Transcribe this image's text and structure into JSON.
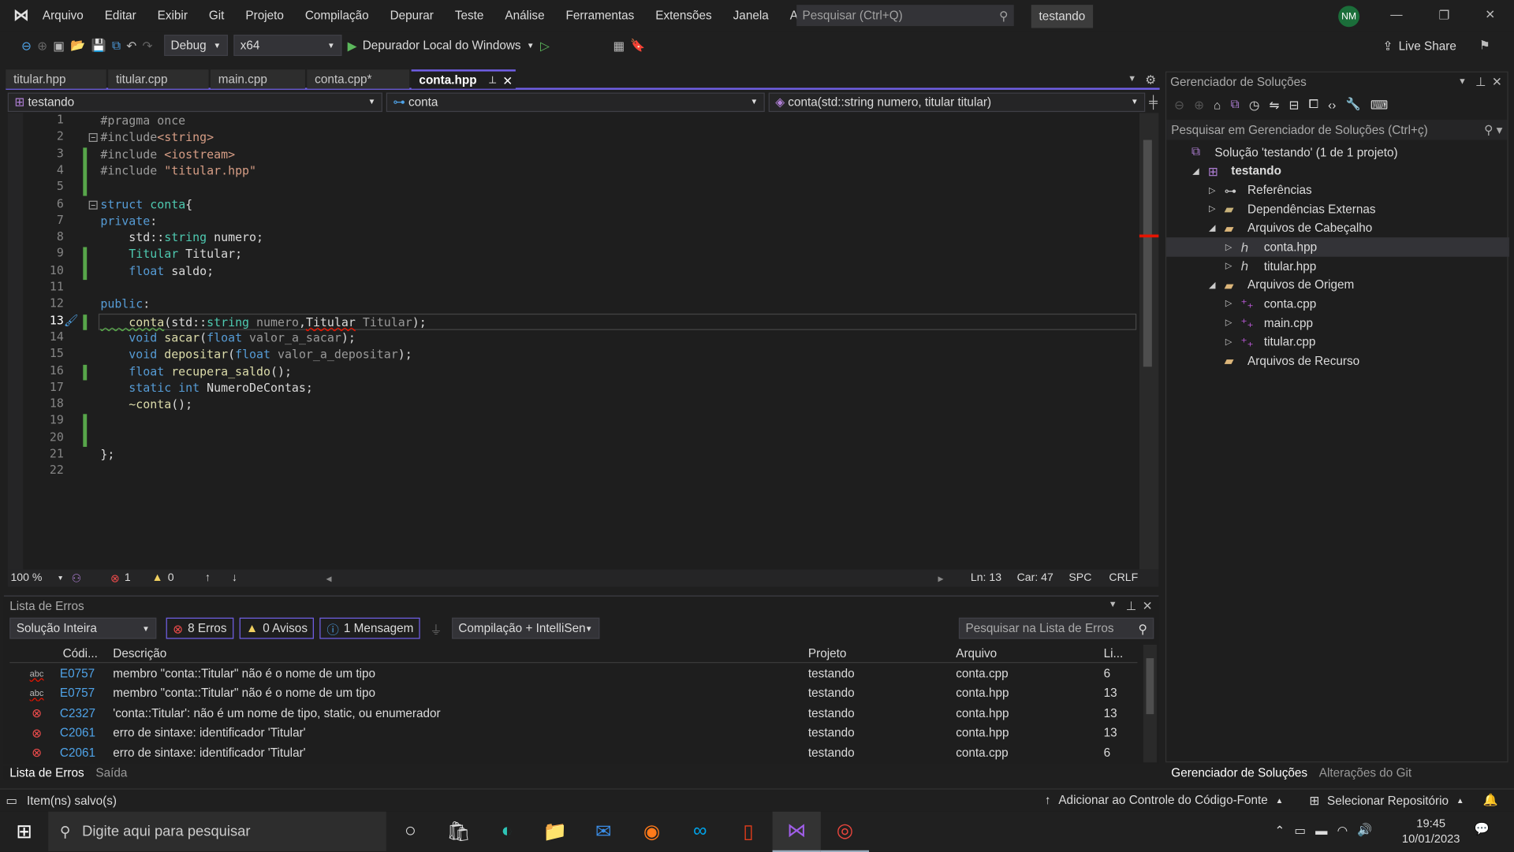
{
  "menu": {
    "items": [
      "Arquivo",
      "Editar",
      "Exibir",
      "Git",
      "Projeto",
      "Compilação",
      "Depurar",
      "Teste",
      "Análise",
      "Ferramentas",
      "Extensões",
      "Janela",
      "Ajuda"
    ],
    "search_placeholder": "Pesquisar (Ctrl+Q)",
    "solution_name": "testando",
    "avatar": "NM"
  },
  "toolbar": {
    "config": "Debug",
    "platform": "x64",
    "run_label": "Depurador Local do Windows",
    "live_share": "Live Share"
  },
  "tabs": [
    {
      "label": "titular.hpp"
    },
    {
      "label": "titular.cpp"
    },
    {
      "label": "main.cpp"
    },
    {
      "label": "conta.cpp*"
    },
    {
      "label": "conta.hpp",
      "active": true
    }
  ],
  "navbar": {
    "project": "testando",
    "scope": "conta",
    "member": "conta(std::string numero, titular titular)"
  },
  "code": {
    "current_line": 13,
    "lines": [
      [
        [
          "pp",
          "#pragma once"
        ]
      ],
      [
        [
          "pp",
          "#include"
        ],
        [
          "s",
          "<string>"
        ]
      ],
      [
        [
          "pp",
          "#include "
        ],
        [
          "s",
          "<iostream>"
        ]
      ],
      [
        [
          "pp",
          "#include "
        ],
        [
          "s",
          "\"titular.hpp\""
        ]
      ],
      [],
      [
        [
          "k",
          "struct "
        ],
        [
          "ty",
          "conta"
        ],
        [
          "p",
          "{"
        ]
      ],
      [
        [
          "k",
          "private"
        ],
        [
          "p",
          ":"
        ]
      ],
      [
        [
          "p",
          "    std::"
        ],
        [
          "ty",
          "string"
        ],
        [
          "m",
          " numero"
        ],
        [
          "p",
          ";"
        ]
      ],
      [
        [
          "ty",
          "    Titular"
        ],
        [
          "m",
          " Titular"
        ],
        [
          "p",
          ";"
        ]
      ],
      [
        [
          "k",
          "    float"
        ],
        [
          "m",
          " saldo"
        ],
        [
          "p",
          ";"
        ]
      ],
      [],
      [
        [
          "k",
          "public"
        ],
        [
          "p",
          ":"
        ]
      ],
      [
        [
          "fn",
          "    conta"
        ],
        [
          "p",
          "(std::"
        ],
        [
          "ty",
          "string"
        ],
        [
          "pa",
          " numero"
        ],
        [
          "p",
          ","
        ],
        [
          "m",
          "Titular"
        ],
        [
          "pa",
          " Titular"
        ],
        [
          "p",
          ");"
        ]
      ],
      [
        [
          "k",
          "    void "
        ],
        [
          "fn",
          "sacar"
        ],
        [
          "p",
          "("
        ],
        [
          "k",
          "float"
        ],
        [
          "pa",
          " valor_a_sacar"
        ],
        [
          "p",
          ");"
        ]
      ],
      [
        [
          "k",
          "    void "
        ],
        [
          "fn",
          "depositar"
        ],
        [
          "p",
          "("
        ],
        [
          "k",
          "float"
        ],
        [
          "pa",
          " valor_a_depositar"
        ],
        [
          "p",
          ");"
        ]
      ],
      [
        [
          "k",
          "    float "
        ],
        [
          "fn",
          "recupera_saldo"
        ],
        [
          "p",
          "();"
        ]
      ],
      [
        [
          "k",
          "    static int "
        ],
        [
          "m",
          "NumeroDeContas"
        ],
        [
          "p",
          ";"
        ]
      ],
      [
        [
          "fn",
          "    ~conta"
        ],
        [
          "p",
          "();"
        ]
      ],
      [],
      [],
      [
        [
          "p",
          "};"
        ]
      ],
      []
    ]
  },
  "editor_status": {
    "zoom": "100 %",
    "errors": "1",
    "warnings": "0",
    "line": "Ln: 13",
    "col": "Car: 47",
    "spaces": "SPC",
    "eol": "CRLF"
  },
  "error_list": {
    "title": "Lista de Erros",
    "scope": "Solução Inteira",
    "errors_filter": "8 Erros",
    "warnings_filter": "0 Avisos",
    "messages_filter": "1 Mensagem",
    "source": "Compilação + IntelliSens",
    "search_placeholder": "Pesquisar na Lista de Erros",
    "columns": [
      "Códi...",
      "Descrição",
      "Projeto",
      "Arquivo",
      "Li..."
    ],
    "rows": [
      {
        "icon": "intellisense-error",
        "code": "E0757",
        "description": "membro \"conta::Titular\" não é o nome de um tipo",
        "project": "testando",
        "file": "conta.cpp",
        "line": "6"
      },
      {
        "icon": "intellisense-error",
        "code": "E0757",
        "description": "membro \"conta::Titular\" não é o nome de um tipo",
        "project": "testando",
        "file": "conta.hpp",
        "line": "13"
      },
      {
        "icon": "error",
        "code": "C2327",
        "description": "'conta::Titular': não é um nome de tipo, static, ou enumerador",
        "project": "testando",
        "file": "conta.hpp",
        "line": "13"
      },
      {
        "icon": "error",
        "code": "C2061",
        "description": "erro de sintaxe: identificador 'Titular'",
        "project": "testando",
        "file": "conta.hpp",
        "line": "13"
      },
      {
        "icon": "error",
        "code": "C2061",
        "description": "erro de sintaxe: identificador 'Titular'",
        "project": "testando",
        "file": "conta.cpp",
        "line": "6"
      }
    ]
  },
  "bottom_tabs": [
    "Lista de Erros",
    "Saída"
  ],
  "solution_explorer": {
    "title": "Gerenciador de Soluções",
    "search_placeholder": "Pesquisar em Gerenciador de Soluções (Ctrl+ç)",
    "items": [
      {
        "label": "Solução 'testando' (1 de 1 projeto)",
        "depth": 0,
        "toggle": "",
        "icon": "solution"
      },
      {
        "label": "testando",
        "depth": 1,
        "toggle": "open",
        "icon": "project",
        "bold": true
      },
      {
        "label": "Referências",
        "depth": 2,
        "toggle": "closed",
        "icon": "references"
      },
      {
        "label": "Dependências Externas",
        "depth": 2,
        "toggle": "closed",
        "icon": "folder"
      },
      {
        "label": "Arquivos de Cabeçalho",
        "depth": 2,
        "toggle": "open",
        "icon": "filter-folder"
      },
      {
        "label": "conta.hpp",
        "depth": 3,
        "toggle": "closed",
        "icon": "header-file",
        "selected": true
      },
      {
        "label": "titular.hpp",
        "depth": 3,
        "toggle": "closed",
        "icon": "header-file"
      },
      {
        "label": "Arquivos de Origem",
        "depth": 2,
        "toggle": "open",
        "icon": "filter-folder"
      },
      {
        "label": "conta.cpp",
        "depth": 3,
        "toggle": "closed",
        "icon": "cpp-file"
      },
      {
        "label": "main.cpp",
        "depth": 3,
        "toggle": "closed",
        "icon": "cpp-file"
      },
      {
        "label": "titular.cpp",
        "depth": 3,
        "toggle": "closed",
        "icon": "cpp-file"
      },
      {
        "label": "Arquivos de Recurso",
        "depth": 2,
        "toggle": "",
        "icon": "filter-folder"
      }
    ],
    "bottom_tabs": [
      "Gerenciador de Soluções",
      "Alterações do Git"
    ]
  },
  "status_bar": {
    "message": "Item(ns) salvo(s)",
    "source_control": "Adicionar ao Controle do Código-Fonte",
    "repo": "Selecionar Repositório"
  },
  "taskbar": {
    "search_placeholder": "Digite aqui para pesquisar",
    "time": "19:45",
    "date": "10/01/2023"
  },
  "colors": {
    "accent": "#7160e8",
    "keyword": "#569cd6",
    "type": "#4ec9b0",
    "string": "#d69d85",
    "error": "#e51400",
    "change_bar": "#57a64a"
  }
}
